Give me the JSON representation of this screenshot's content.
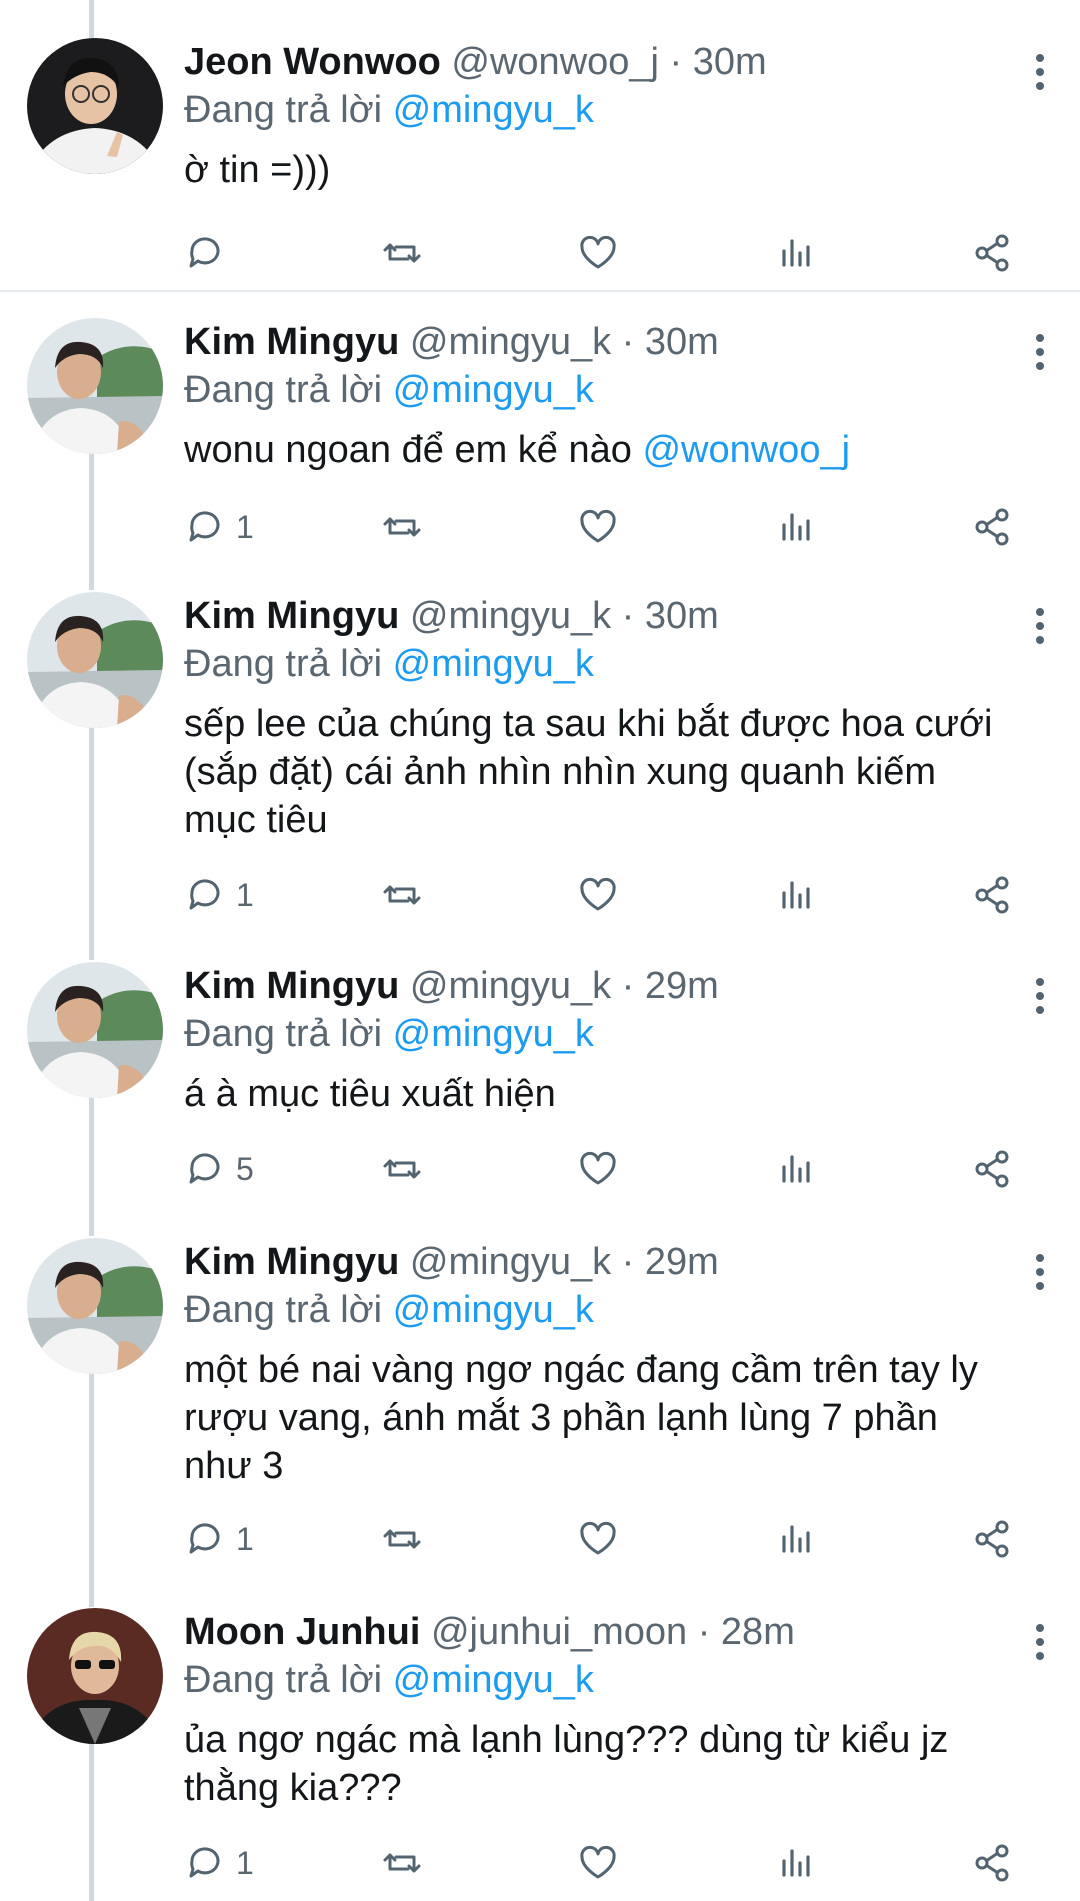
{
  "reply_prefix": "Đang trả lời",
  "tweets": [
    {
      "name": "Jeon Wonwoo",
      "handle": "@wonwoo_j",
      "separator": "·",
      "time": "30m",
      "replying_to": "@mingyu_k",
      "text_lines": [
        "ờ tin =)))"
      ],
      "text_mention": "",
      "reply_count": "",
      "avatar": "avatar-wonwoo"
    },
    {
      "name": "Kim Mingyu",
      "handle": "@mingyu_k",
      "separator": "·",
      "time": "30m",
      "replying_to": "@mingyu_k",
      "text_lines": [
        "wonu ngoan để em kể nào "
      ],
      "text_mention": "@wonwoo_j",
      "reply_count": "1",
      "avatar": "avatar-mingyu"
    },
    {
      "name": "Kim Mingyu",
      "handle": "@mingyu_k",
      "separator": "·",
      "time": "30m",
      "replying_to": "@mingyu_k",
      "text_lines": [
        "sếp lee của chúng ta sau khi bắt được hoa cưới",
        "(sắp đặt) cái ảnh nhìn nhìn xung quanh kiếm",
        "mục tiêu"
      ],
      "text_mention": "",
      "reply_count": "1",
      "avatar": "avatar-mingyu"
    },
    {
      "name": "Kim Mingyu",
      "handle": "@mingyu_k",
      "separator": "·",
      "time": "29m",
      "replying_to": "@mingyu_k",
      "text_lines": [
        "á à mục tiêu xuất hiện"
      ],
      "text_mention": "",
      "reply_count": "5",
      "avatar": "avatar-mingyu"
    },
    {
      "name": "Kim Mingyu",
      "handle": "@mingyu_k",
      "separator": "·",
      "time": "29m",
      "replying_to": "@mingyu_k",
      "text_lines": [
        "một bé nai vàng ngơ ngác đang cầm trên tay ly",
        "rượu vang, ánh mắt 3 phần lạnh lùng 7 phần",
        "như 3"
      ],
      "text_mention": "",
      "reply_count": "1",
      "avatar": "avatar-mingyu"
    },
    {
      "name": "Moon Junhui",
      "handle": "@junhui_moon",
      "separator": "·",
      "time": "28m",
      "replying_to": "@mingyu_k",
      "text_lines": [
        "ủa ngơ ngác mà lạnh lùng??? dùng từ kiểu jz",
        "thằng kia???"
      ],
      "text_mention": "",
      "reply_count": "1",
      "avatar": "avatar-junhui"
    }
  ],
  "icons": {
    "reply": "reply-icon",
    "retweet": "retweet-icon",
    "like": "heart-icon",
    "stats": "analytics-icon",
    "share": "share-icon",
    "more": "more-vertical-icon"
  },
  "colors": {
    "mention": "#1d9bf0",
    "secondary_text": "#5b6770",
    "icon": "#536471",
    "thread_line": "#cfd9de"
  }
}
